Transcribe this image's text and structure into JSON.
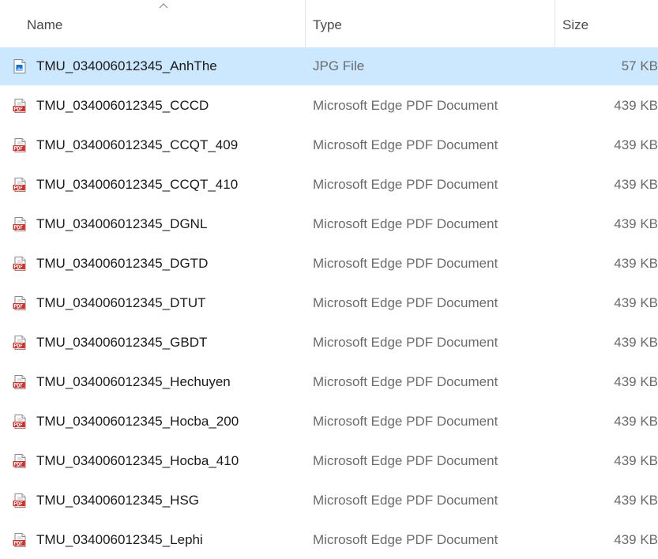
{
  "columns": {
    "name": "Name",
    "type": "Type",
    "size": "Size"
  },
  "colors": {
    "selected_row": "#cce8ff",
    "pdf_icon_red": "#d0302a",
    "jpg_icon_blue": "#1e6fd0"
  },
  "files": [
    {
      "name": "TMU_034006012345_AnhThe",
      "type": "JPG File",
      "size": "57 KB",
      "icon": "image-file-icon",
      "selected": true
    },
    {
      "name": "TMU_034006012345_CCCD",
      "type": "Microsoft Edge PDF Document",
      "size": "439 KB",
      "icon": "pdf-file-icon"
    },
    {
      "name": "TMU_034006012345_CCQT_409",
      "type": "Microsoft Edge PDF Document",
      "size": "439 KB",
      "icon": "pdf-file-icon"
    },
    {
      "name": "TMU_034006012345_CCQT_410",
      "type": "Microsoft Edge PDF Document",
      "size": "439 KB",
      "icon": "pdf-file-icon"
    },
    {
      "name": "TMU_034006012345_DGNL",
      "type": "Microsoft Edge PDF Document",
      "size": "439 KB",
      "icon": "pdf-file-icon"
    },
    {
      "name": "TMU_034006012345_DGTD",
      "type": "Microsoft Edge PDF Document",
      "size": "439 KB",
      "icon": "pdf-file-icon"
    },
    {
      "name": "TMU_034006012345_DTUT",
      "type": "Microsoft Edge PDF Document",
      "size": "439 KB",
      "icon": "pdf-file-icon"
    },
    {
      "name": "TMU_034006012345_GBDT",
      "type": "Microsoft Edge PDF Document",
      "size": "439 KB",
      "icon": "pdf-file-icon"
    },
    {
      "name": "TMU_034006012345_Hechuyen",
      "type": "Microsoft Edge PDF Document",
      "size": "439 KB",
      "icon": "pdf-file-icon"
    },
    {
      "name": "TMU_034006012345_Hocba_200",
      "type": "Microsoft Edge PDF Document",
      "size": "439 KB",
      "icon": "pdf-file-icon"
    },
    {
      "name": "TMU_034006012345_Hocba_410",
      "type": "Microsoft Edge PDF Document",
      "size": "439 KB",
      "icon": "pdf-file-icon"
    },
    {
      "name": "TMU_034006012345_HSG",
      "type": "Microsoft Edge PDF Document",
      "size": "439 KB",
      "icon": "pdf-file-icon"
    },
    {
      "name": "TMU_034006012345_Lephi",
      "type": "Microsoft Edge PDF Document",
      "size": "439 KB",
      "icon": "pdf-file-icon"
    }
  ]
}
